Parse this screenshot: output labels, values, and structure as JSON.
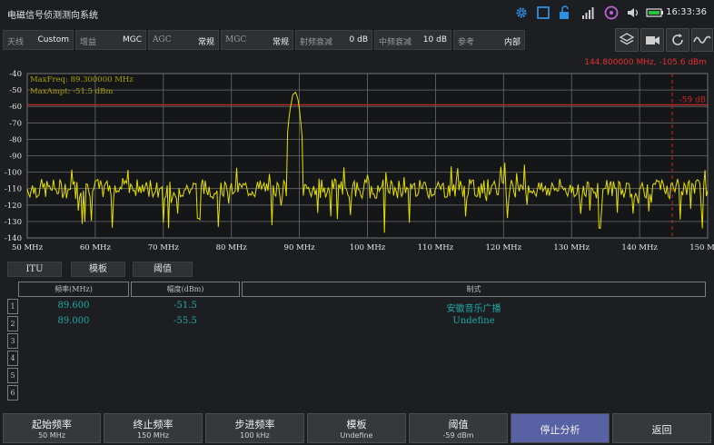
{
  "status_bar": {
    "app_title": "电磁信号侦测测向系统",
    "time": "16:33:36"
  },
  "params": [
    {
      "label": "天线",
      "value": "Custom"
    },
    {
      "label": "增益",
      "value": "MGC"
    },
    {
      "label": "AGC",
      "value": "常规"
    },
    {
      "label": "MGC",
      "value": "常规"
    },
    {
      "label": "射频衰减",
      "value": "0 dB"
    },
    {
      "label": "中频衰减",
      "value": "10 dB"
    },
    {
      "label": "参考",
      "value": "内部"
    }
  ],
  "toolbar_icons": [
    "layers-icon",
    "video-record-icon",
    "refresh-icon",
    "waveform-icon"
  ],
  "marker": {
    "readout": "144.800000 MHz, -105.6 dBm",
    "frequency_mhz": 144.8
  },
  "threshold": {
    "label": "-59 dB",
    "value_dbm": -59
  },
  "spectrum_info": {
    "max_freq": "MaxFreq:   89.300000 MHz",
    "max_ampt": "MaxAmpt:  -51.5 dBm"
  },
  "chart_data": {
    "type": "line",
    "xlim": [
      50,
      150
    ],
    "ylim": [
      -140,
      -40
    ],
    "x_ticks": [
      "50 MHz",
      "60 MHz",
      "70 MHz",
      "80 MHz",
      "90 MHz",
      "100 MHz",
      "110 MHz",
      "120 MHz",
      "130 MHz",
      "140 MHz",
      "150 MHz"
    ],
    "y_ticks": [
      "-40",
      "-50",
      "-60",
      "-70",
      "-80",
      "-90",
      "-100",
      "-110",
      "-120",
      "-130",
      "-140"
    ],
    "noise_floor_dbm": -110,
    "peak": {
      "frequency_mhz": 89.3,
      "amplitude_dbm": -51.5
    },
    "grid": true
  },
  "tabs": [
    "ITU",
    "模板",
    "阈值"
  ],
  "table": {
    "headers": [
      "频率(MHz)",
      "幅度(dBm)",
      "制式"
    ],
    "row_numbers": [
      "1",
      "2",
      "3",
      "4",
      "5",
      "6"
    ],
    "rows": [
      [
        "89.600",
        "-51.5",
        "安徽音乐广播"
      ],
      [
        "89.000",
        "-55.5",
        "Undefine"
      ]
    ]
  },
  "bottom_buttons": [
    {
      "title": "起始频率",
      "sub": "50 MHz"
    },
    {
      "title": "终止频率",
      "sub": "150 MHz"
    },
    {
      "title": "步进频率",
      "sub": "100 kHz"
    },
    {
      "title": "模板",
      "sub": "Undefine"
    },
    {
      "title": "阈值",
      "sub": "-59 dBm"
    },
    {
      "title": "停止分析",
      "sub": ""
    },
    {
      "title": "返回",
      "sub": ""
    }
  ],
  "colors": {
    "trace": "#e4e000",
    "threshold": "#c02a2a",
    "marker": "#d02020",
    "table_text": "#1fa9a9",
    "active_button": "#5861a3"
  }
}
